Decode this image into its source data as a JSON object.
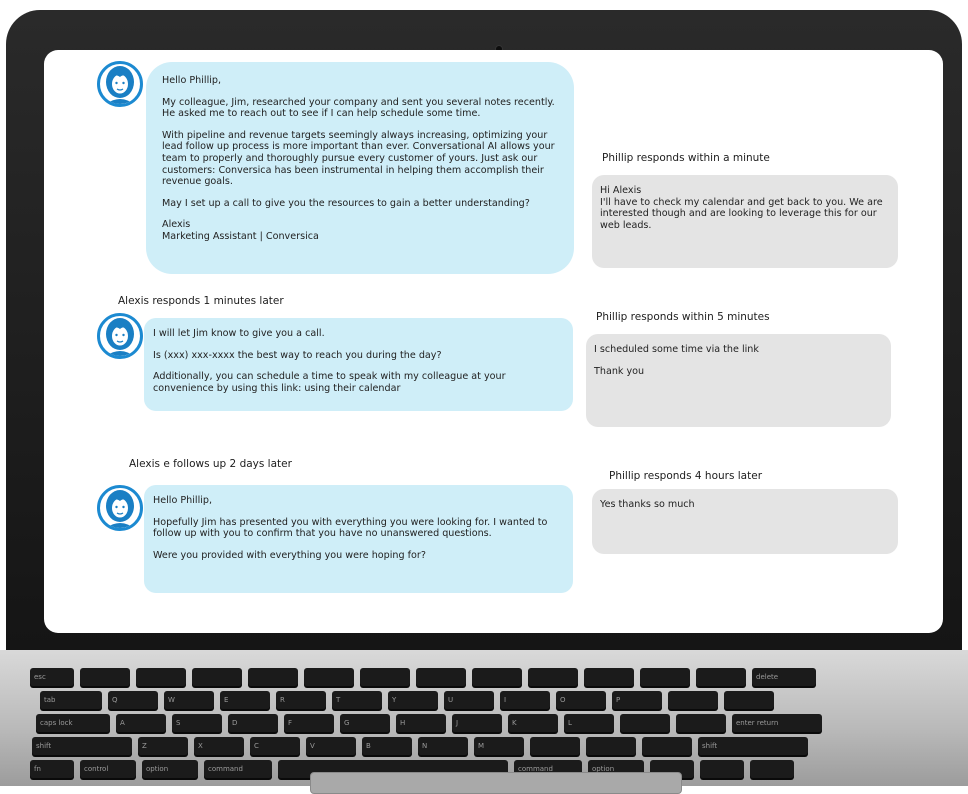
{
  "left_column": {
    "message_1": {
      "lines": [
        "Hello Phillip,",
        "My colleague, Jim, researched your company and sent you several notes recently. He asked me to reach out to see if I can help schedule some time.",
        "With pipeline and revenue targets seemingly always increasing, optimizing your lead follow up process is more important than ever. Conversational AI allows your team to properly and thoroughly pursue every customer of yours. Just ask our customers: Conversica has been instrumental in helping them accomplish their revenue goals.",
        "May I set up a call to give you the resources to gain a better understanding?",
        "Alexis\nMarketing Assistant | Conversica"
      ]
    },
    "label_2": "Alexis  responds  1 minutes later",
    "message_2": {
      "lines": [
        "I will let Jim know to give you a call.",
        "Is (xxx) xxx-xxxx the best way to reach you during the day?",
        "Additionally, you can schedule a time to speak with my colleague at your convenience by using this link: using their calendar"
      ]
    },
    "label_3": "Alexis e follows up 2 days later",
    "message_3": {
      "lines": [
        "Hello Phillip,",
        "Hopefully Jim has presented you with everything you were looking for. I wanted to follow up with you to confirm that you have no unanswered questions.",
        "Were you provided with everything you were hoping for?"
      ]
    }
  },
  "right_column": {
    "label_1": "Phillip responds within a minute",
    "reply_1": "Hi Alexis\nI'll have to check my calendar and get back to you. We are interested though and are looking to leverage this for our web leads.",
    "label_2": "Phillip responds within 5 minutes",
    "reply_2": {
      "lines": [
        "I scheduled some time via the link",
        "Thank you"
      ]
    },
    "label_3": "Phillip responds 4 hours  later",
    "reply_3": "Yes thanks so much"
  },
  "icons": {
    "avatar": "woman-avatar-icon",
    "camera": "webcam-icon"
  },
  "colors": {
    "agent_bubble": "#cfeef8",
    "reply_bubble": "#e4e4e4",
    "avatar_ring": "#1c8ad1"
  },
  "keyboard": {
    "row_1": [
      "esc",
      "",
      "",
      "",
      "",
      "",
      "",
      "",
      "",
      "",
      "",
      "",
      "",
      "delete"
    ],
    "row_2": [
      "tab",
      "Q",
      "W",
      "E",
      "R",
      "T",
      "Y",
      "U",
      "I",
      "O",
      "P",
      "",
      ""
    ],
    "row_3": [
      "caps lock",
      "A",
      "S",
      "D",
      "F",
      "G",
      "H",
      "J",
      "K",
      "L",
      "",
      "",
      "enter return"
    ],
    "row_4": [
      "shift",
      "Z",
      "X",
      "C",
      "V",
      "B",
      "N",
      "M",
      "",
      "",
      "",
      "shift"
    ],
    "row_5": [
      "fn",
      "control",
      "option",
      "command",
      "",
      "command",
      "option",
      "",
      "",
      ""
    ]
  }
}
